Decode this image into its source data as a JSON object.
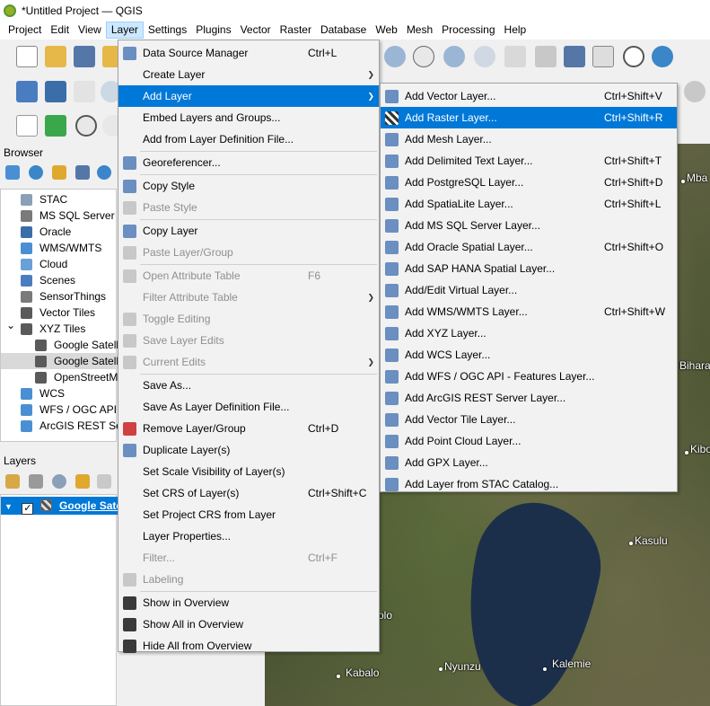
{
  "window": {
    "title": "*Untitled Project — QGIS"
  },
  "menubar": [
    "Project",
    "Edit",
    "View",
    "Layer",
    "Settings",
    "Plugins",
    "Vector",
    "Raster",
    "Database",
    "Web",
    "Mesh",
    "Processing",
    "Help"
  ],
  "browser": {
    "title": "Browser",
    "items": [
      {
        "label": "STAC",
        "icon": "stac-icon",
        "indent": 1
      },
      {
        "label": "MS SQL Server",
        "icon": "mssql-icon",
        "indent": 1
      },
      {
        "label": "Oracle",
        "icon": "oracle-icon",
        "indent": 1
      },
      {
        "label": "WMS/WMTS",
        "icon": "globe-icon",
        "indent": 1
      },
      {
        "label": "Cloud",
        "icon": "cloud-icon",
        "indent": 1
      },
      {
        "label": "Scenes",
        "icon": "scenes-icon",
        "indent": 1
      },
      {
        "label": "SensorThings",
        "icon": "sensor-icon",
        "indent": 1
      },
      {
        "label": "Vector Tiles",
        "icon": "grid-icon",
        "indent": 1
      },
      {
        "label": "XYZ Tiles",
        "icon": "grid-icon",
        "indent": 1,
        "expanded": true
      },
      {
        "label": "Google Satell",
        "icon": "grid-icon",
        "indent": 2
      },
      {
        "label": "Google Satell",
        "icon": "grid-icon",
        "indent": 2,
        "selected": true
      },
      {
        "label": "OpenStreetM",
        "icon": "grid-icon",
        "indent": 2
      },
      {
        "label": "WCS",
        "icon": "globe-icon",
        "indent": 1
      },
      {
        "label": "WFS / OGC API -",
        "icon": "globe-icon",
        "indent": 1
      },
      {
        "label": "ArcGIS REST Serv",
        "icon": "globe-icon",
        "indent": 1
      }
    ]
  },
  "layers": {
    "title": "Layers",
    "items": [
      {
        "label": "Google Sate",
        "checked": true
      }
    ]
  },
  "layer_menu": [
    {
      "label": "Data Source Manager",
      "shortcut": "Ctrl+L",
      "icon": "data-source-icon",
      "underline": "D"
    },
    {
      "label": "Create Layer",
      "submenu": true
    },
    {
      "label": "Add Layer",
      "submenu": true,
      "highlighted": true
    },
    {
      "label": "Embed Layers and Groups..."
    },
    {
      "label": "Add from Layer Definition File..."
    },
    {
      "label": "Georeferencer...",
      "icon": "georeferencer-icon",
      "separator_before": true
    },
    {
      "label": "Copy Style",
      "icon": "copy-style-icon",
      "separator_before": true
    },
    {
      "label": "Paste Style",
      "icon": "paste-style-icon",
      "disabled": true
    },
    {
      "label": "Copy Layer",
      "icon": "copy-layer-icon",
      "separator_before": true
    },
    {
      "label": "Paste Layer/Group",
      "icon": "paste-layer-icon",
      "disabled": true
    },
    {
      "label": "Open Attribute Table",
      "shortcut": "F6",
      "icon": "table-icon",
      "disabled": true,
      "separator_before": true
    },
    {
      "label": "Filter Attribute Table",
      "submenu": true,
      "disabled": true
    },
    {
      "label": "Toggle Editing",
      "icon": "pencil-icon",
      "disabled": true
    },
    {
      "label": "Save Layer Edits",
      "icon": "save-edits-icon",
      "disabled": true
    },
    {
      "label": "Current Edits",
      "submenu": true,
      "icon": "edits-icon",
      "disabled": true
    },
    {
      "label": "Save As...",
      "separator_before": true
    },
    {
      "label": "Save As Layer Definition File..."
    },
    {
      "label": "Remove Layer/Group",
      "shortcut": "Ctrl+D",
      "icon": "remove-icon"
    },
    {
      "label": "Duplicate Layer(s)",
      "icon": "duplicate-icon"
    },
    {
      "label": "Set Scale Visibility of Layer(s)"
    },
    {
      "label": "Set CRS of Layer(s)",
      "shortcut": "Ctrl+Shift+C"
    },
    {
      "label": "Set Project CRS from Layer"
    },
    {
      "label": "Layer Properties..."
    },
    {
      "label": "Filter...",
      "shortcut": "Ctrl+F",
      "disabled": true
    },
    {
      "label": "Labeling",
      "icon": "labeling-icon",
      "disabled": true
    },
    {
      "label": "Show in Overview",
      "icon": "overview-icon",
      "separator_before": true
    },
    {
      "label": "Show All in Overview",
      "icon": "overview-icon"
    },
    {
      "label": "Hide All from Overview",
      "icon": "hide-overview-icon"
    }
  ],
  "add_layer_menu": [
    {
      "label": "Add Vector Layer...",
      "shortcut": "Ctrl+Shift+V",
      "icon": "vector-icon"
    },
    {
      "label": "Add Raster Layer...",
      "shortcut": "Ctrl+Shift+R",
      "icon": "raster-icon",
      "highlighted": true
    },
    {
      "label": "Add Mesh Layer...",
      "icon": "mesh-icon"
    },
    {
      "label": "Add Delimited Text Layer...",
      "shortcut": "Ctrl+Shift+T",
      "icon": "delimited-text-icon"
    },
    {
      "label": "Add PostgreSQL Layer...",
      "shortcut": "Ctrl+Shift+D",
      "icon": "postgresql-icon"
    },
    {
      "label": "Add SpatiaLite Layer...",
      "shortcut": "Ctrl+Shift+L",
      "icon": "spatialite-icon"
    },
    {
      "label": "Add MS SQL Server Layer...",
      "icon": "mssql-icon"
    },
    {
      "label": "Add Oracle Spatial Layer...",
      "shortcut": "Ctrl+Shift+O",
      "icon": "oracle-icon"
    },
    {
      "label": "Add SAP HANA Spatial Layer...",
      "icon": "hana-icon"
    },
    {
      "label": "Add/Edit Virtual Layer...",
      "icon": "virtual-layer-icon"
    },
    {
      "label": "Add WMS/WMTS Layer...",
      "shortcut": "Ctrl+Shift+W",
      "icon": "wms-icon"
    },
    {
      "label": "Add XYZ Layer...",
      "icon": "xyz-icon"
    },
    {
      "label": "Add WCS Layer...",
      "icon": "wcs-icon"
    },
    {
      "label": "Add WFS / OGC API - Features Layer...",
      "icon": "wfs-icon"
    },
    {
      "label": "Add ArcGIS REST Server Layer...",
      "icon": "arcgis-icon"
    },
    {
      "label": "Add Vector Tile Layer...",
      "icon": "vector-tile-icon"
    },
    {
      "label": "Add Point Cloud Layer...",
      "icon": "point-cloud-icon"
    },
    {
      "label": "Add GPX Layer...",
      "icon": "gpx-icon"
    },
    {
      "label": "Add Layer from STAC Catalog...",
      "icon": "stac-icon"
    }
  ],
  "map_labels": [
    "Mba",
    "Bihara",
    "Kibo",
    "Kasulu",
    "olo",
    "Kabalo",
    "Nyunzu",
    "Kalemie"
  ],
  "colors": {
    "highlight": "#0078d7",
    "menu_bg": "#f2f2f2",
    "disabled": "#8f8f8f"
  }
}
